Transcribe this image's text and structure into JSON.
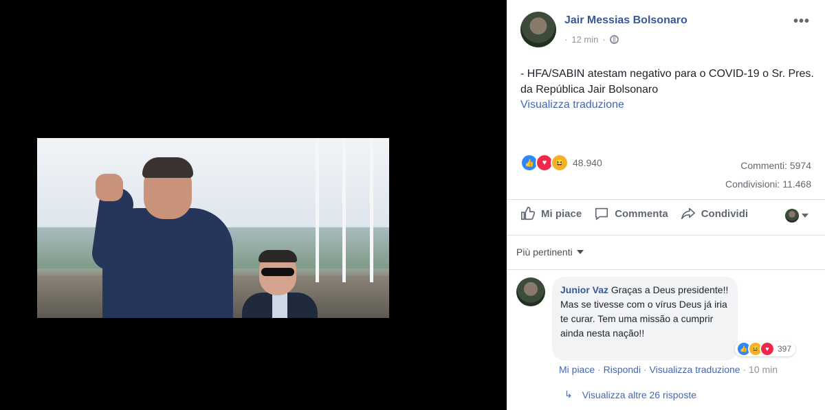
{
  "post": {
    "author": "Jair Messias Bolsonaro",
    "time": "12 min",
    "text": "- HFA/SABIN atestam negativo para o COVID-19 o Sr. Pres. da República Jair Bolsonaro",
    "translate_link": "Visualizza traduzione",
    "reactions_count": "48.940",
    "comments": "Commenti: 5974",
    "shares": "Condivisioni: 11.468",
    "more_icon": "ellipsis-icon",
    "privacy_icon": "globe-icon"
  },
  "actions": {
    "like": "Mi piace",
    "comment": "Commenta",
    "share": "Condividi"
  },
  "comments_section": {
    "sort_label": "Più pertinenti",
    "comment": {
      "author": "Junior Vaz",
      "text": "Graças a Deus presidente!! Mas se tivesse com o vírus Deus já iria te curar. Tem uma missão a cumprir ainda nesta nação!!",
      "reactions_count": "397",
      "like_link": "Mi piace",
      "reply_link": "Rispondi",
      "translate_link": "Visualizza traduzione",
      "time": "10 min"
    },
    "view_replies": "Visualizza altre 26 risposte"
  },
  "colors": {
    "link": "#365899",
    "secondary_text": "#90949c",
    "like_blue": "#2d88ff",
    "love_red": "#f0284a",
    "haha_yellow": "#f7b125"
  }
}
